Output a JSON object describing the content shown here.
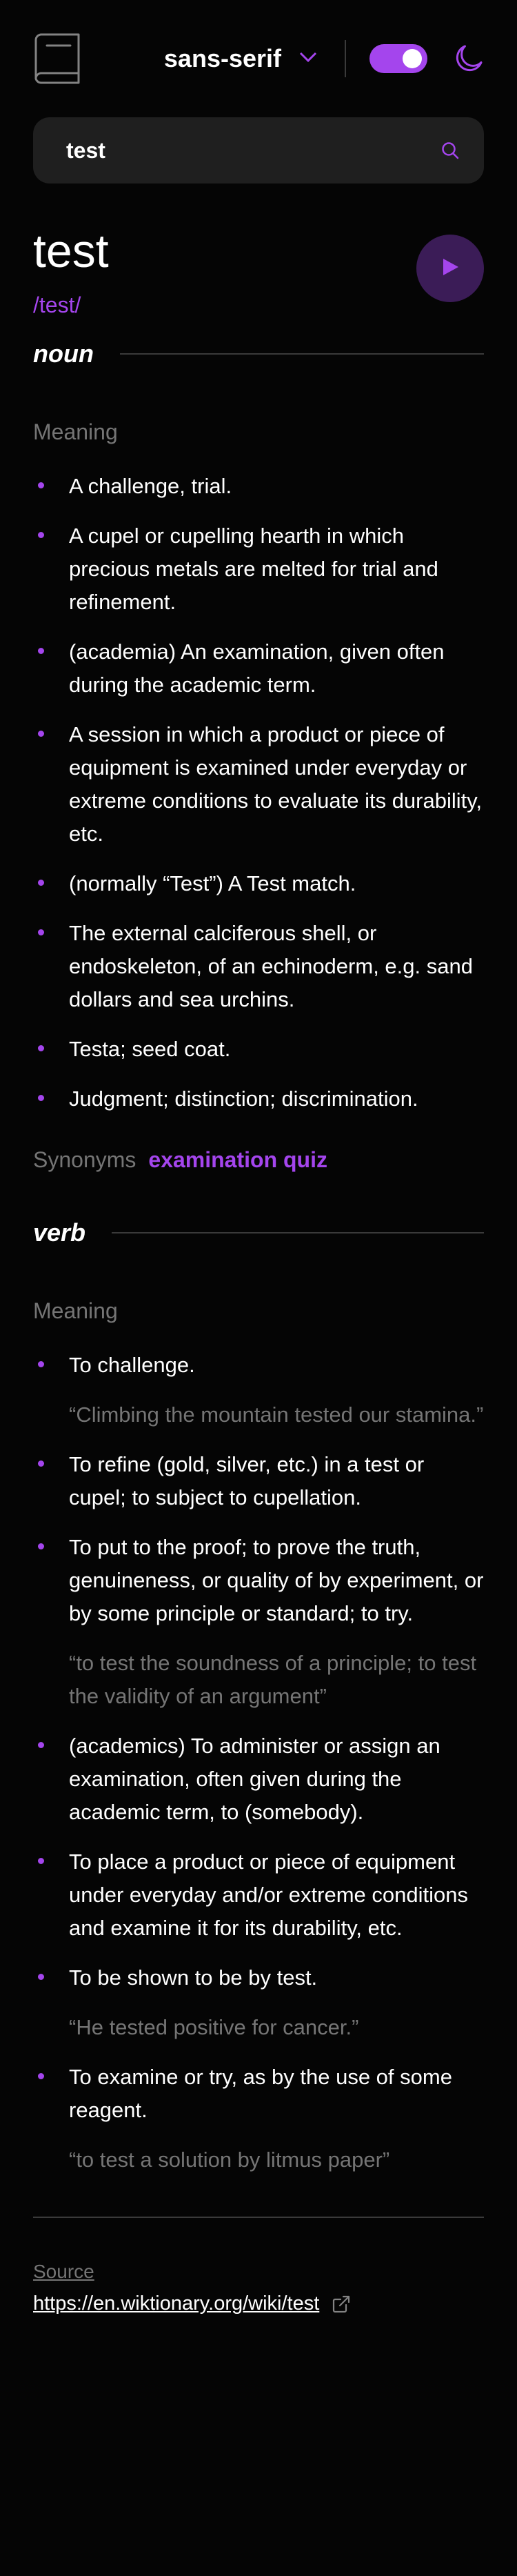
{
  "header": {
    "logo_icon": "book-icon",
    "font_label": "sans-serif",
    "dropdown_icon": "chevron-down-icon",
    "theme_toggle": "on",
    "theme_icon": "moon-icon"
  },
  "search": {
    "value": "test",
    "icon": "search-icon"
  },
  "word": {
    "title": "test",
    "phonetic": "/test/",
    "play_icon": "play-icon"
  },
  "noun": {
    "pos": "noun",
    "meaning_label": "Meaning",
    "definitions": [
      "A challenge, trial.",
      "A cupel or cupelling hearth in which precious metals are melted for trial and refinement.",
      "(academia) An examination, given often during the academic term.",
      "A session in which a product or piece of equipment is examined under everyday or extreme conditions to evaluate its durability, etc.",
      "(normally “Test”) A Test match.",
      "The external calciferous shell, or endoskeleton, of an echinoderm, e.g. sand dollars and sea urchins.",
      "Testa; seed coat.",
      "Judgment; distinction; discrimination."
    ],
    "synonyms_label": "Synonyms",
    "synonyms": "examination quiz"
  },
  "verb": {
    "pos": "verb",
    "meaning_label": "Meaning",
    "definitions": [
      {
        "text": "To challenge.",
        "example": "“Climbing the mountain tested our stamina.”"
      },
      {
        "text": "To refine (gold, silver, etc.) in a test or cupel; to subject to cupellation."
      },
      {
        "text": "To put to the proof; to prove the truth, genuineness, or quality of by experiment, or by some principle or standard; to try.",
        "example": "“to test the soundness of a principle; to test the validity of an argument”"
      },
      {
        "text": "(academics) To administer or assign an examination, often given during the academic term, to (somebody)."
      },
      {
        "text": "To place a product or piece of equipment under everyday and/or extreme conditions and examine it for its durability, etc."
      },
      {
        "text": "To be shown to be by test.",
        "example": "“He tested positive for cancer.”"
      },
      {
        "text": "To examine or try, as by the use of some reagent.",
        "example": "“to test a solution by litmus paper”"
      }
    ]
  },
  "source": {
    "label": "Source",
    "url": "https://en.wiktionary.org/wiki/test",
    "icon": "external-link-icon"
  },
  "colors": {
    "accent": "#a445ed",
    "background": "#050505",
    "muted": "#757575"
  }
}
